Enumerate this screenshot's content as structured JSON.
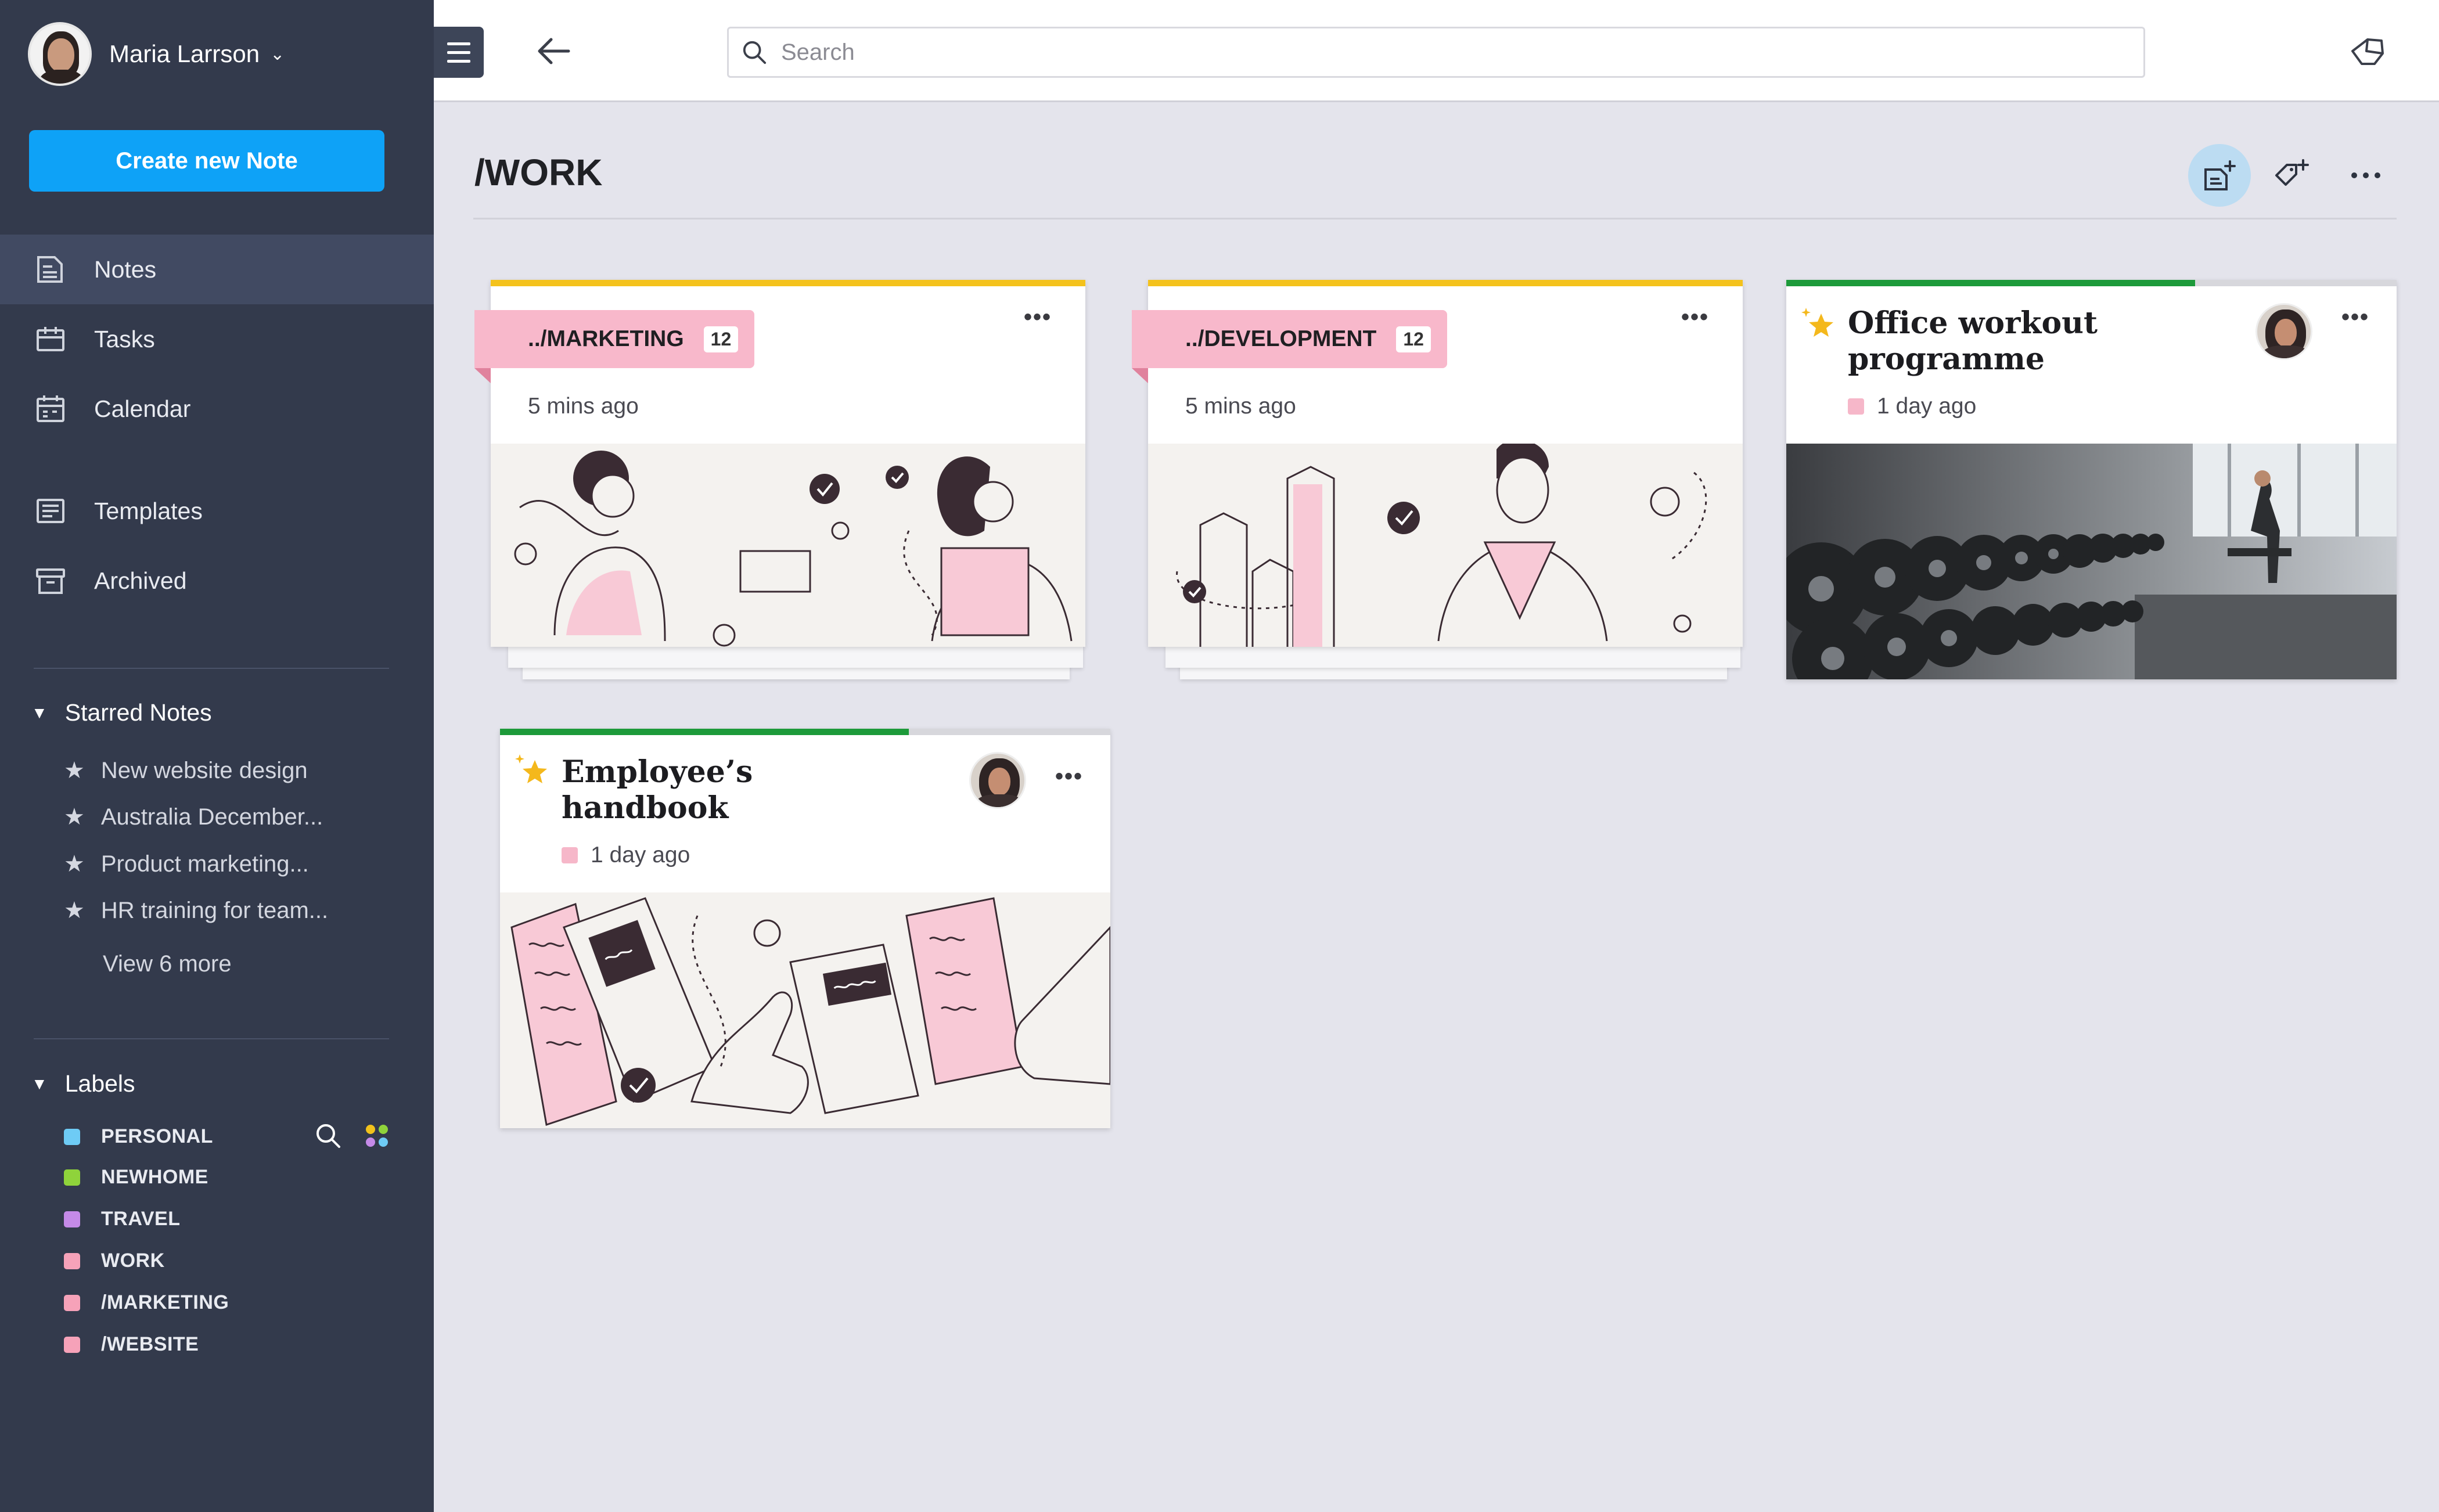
{
  "user": {
    "name": "Maria Larrson"
  },
  "sidebar": {
    "create_button": "Create new Note",
    "nav": [
      {
        "label": "Notes",
        "icon": "notes-icon",
        "active": true
      },
      {
        "label": "Tasks",
        "icon": "tasks-icon"
      },
      {
        "label": "Calendar",
        "icon": "calendar-icon"
      },
      {
        "label": "Templates",
        "icon": "templates-icon"
      },
      {
        "label": "Archived",
        "icon": "archive-icon"
      }
    ],
    "starred": {
      "heading": "Starred Notes",
      "items": [
        "New website design",
        "Australia December...",
        "Product marketing...",
        "HR training for team..."
      ],
      "view_more": "View 6 more"
    },
    "labels": {
      "heading": "Labels",
      "items": [
        {
          "name": "PERSONAL",
          "color": "#6ecbf5"
        },
        {
          "name": "NEWHOME",
          "color": "#8fd33b"
        },
        {
          "name": "TRAVEL",
          "color": "#c58ae8"
        },
        {
          "name": "WORK",
          "color": "#f6a2b9"
        },
        {
          "name": "/MARKETING",
          "color": "#f6a2b9"
        },
        {
          "name": "/WEBSITE",
          "color": "#f6a2b9"
        }
      ]
    }
  },
  "topbar": {
    "search_placeholder": "Search"
  },
  "main": {
    "title": "/WORK",
    "cards": [
      {
        "type": "folder",
        "name": "../MARKETING",
        "count": "12",
        "time": "5 mins ago",
        "accent": "#f4c21c"
      },
      {
        "type": "folder",
        "name": "../DEVELOPMENT",
        "count": "12",
        "time": "5 mins ago",
        "accent": "#f4c21c"
      },
      {
        "type": "note",
        "title": "Office workout programme",
        "time": "1 day ago",
        "accent": "#1d9a3a",
        "progress": 0.67,
        "starred": true
      },
      {
        "type": "note",
        "title": "Employee’s handbook",
        "time": "1 day ago",
        "accent": "#1d9a3a",
        "progress": 0.67,
        "starred": true
      }
    ]
  },
  "colors": {
    "sidebar_bg": "#333a4c",
    "accent_blue": "#0ea2f7",
    "folder_pink": "#f8b8cb"
  }
}
